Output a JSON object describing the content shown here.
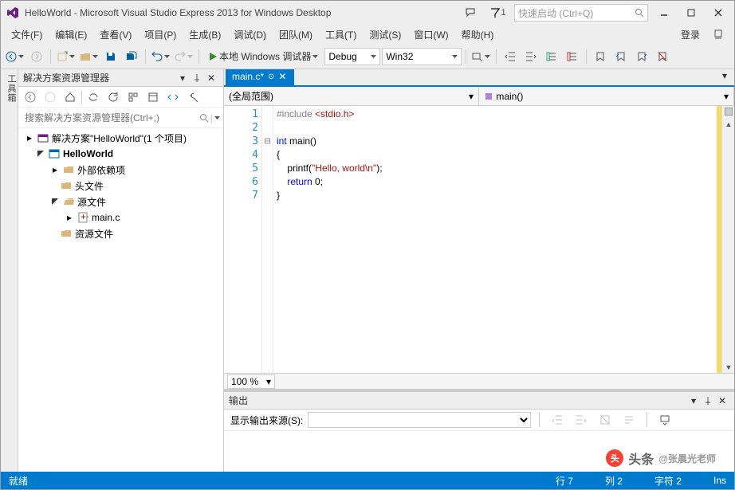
{
  "title": "HelloWorld - Microsoft Visual Studio Express 2013 for Windows Desktop",
  "notification_count": "1",
  "quick_launch_placeholder": "快速启动 (Ctrl+Q)",
  "menus": [
    "文件(F)",
    "编辑(E)",
    "查看(V)",
    "项目(P)",
    "生成(B)",
    "调试(D)",
    "团队(M)",
    "工具(T)",
    "测试(S)",
    "窗口(W)",
    "帮助(H)"
  ],
  "login": "登录",
  "toolbar": {
    "start_label": "本地 Windows 调试器",
    "config": "Debug",
    "platform": "Win32"
  },
  "side_tab": "工具箱",
  "explorer": {
    "title": "解决方案资源管理器",
    "search_placeholder": "搜索解决方案资源管理器(Ctrl+;)",
    "solution": "解决方案\"HelloWorld\"(1 个项目)",
    "project": "HelloWorld",
    "ext_deps": "外部依赖项",
    "headers": "头文件",
    "sources": "源文件",
    "main_c": "main.c",
    "resources": "资源文件"
  },
  "tab": {
    "name": "main.c*"
  },
  "dropdown": {
    "scope": "(全局范围)",
    "member": "main()"
  },
  "code": {
    "l1a": "#include ",
    "l1b": "<stdio.h>",
    "l3a": "int",
    "l3b": " main()",
    "l4": "{",
    "l5a": "    printf(",
    "l5b": "\"Hello, world\\n\"",
    "l5c": ");",
    "l6a": "    ",
    "l6b": "return",
    "l6c": " 0;",
    "l7": "}"
  },
  "zoom": "100 %",
  "output": {
    "title": "输出",
    "src_label": "显示输出来源(S):"
  },
  "status": {
    "ready": "就绪",
    "line": "行 7",
    "col": "列 2",
    "char": "字符 2",
    "ins": "Ins"
  },
  "watermark": "@张晨光老师",
  "watermark_pre": "头条"
}
